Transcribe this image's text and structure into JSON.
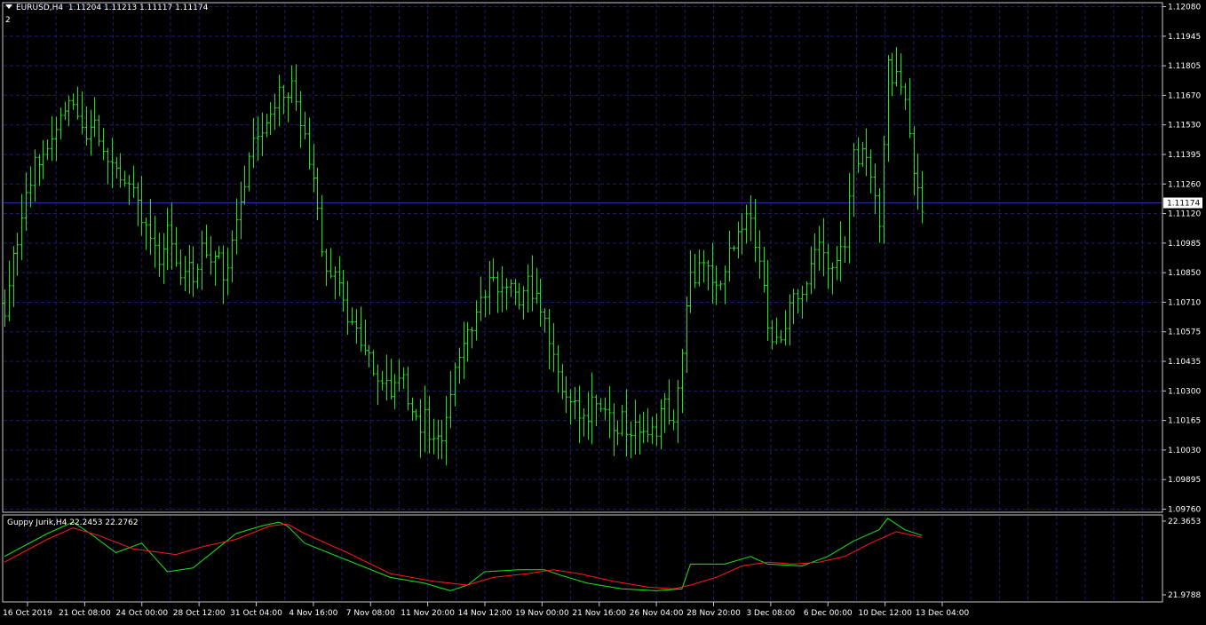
{
  "header": {
    "symbol": "EURUSD,H4",
    "ohlc": "1.11204 1.11213 1.11117 1.11174",
    "line2": "2"
  },
  "indicator": {
    "label": "Guppy Jurik,H4 22.2453 22.2762"
  },
  "colors": {
    "background": "#000000",
    "grid": "#1c1c6e",
    "bars": "#19e619",
    "price_line": "#2a2aa8",
    "price_tag_bg": "#ffffff",
    "fast_line": "#19e619",
    "slow_line": "#ff1a1a",
    "axis": "#c8c8c8"
  },
  "chart_data": [
    {
      "type": "ohlc",
      "title": "EURUSD,H4",
      "ylim": [
        1.0976,
        1.1208
      ],
      "y_ticks": [
        "1.12080",
        "1.11945",
        "1.11805",
        "1.11670",
        "1.11530",
        "1.11395",
        "1.11260",
        "1.11120",
        "1.10985",
        "1.10850",
        "1.10710",
        "1.10575",
        "1.10435",
        "1.10300",
        "1.10165",
        "1.10030",
        "1.09895",
        "1.09760"
      ],
      "current_price": "1.11174",
      "x_labels": [
        "16 Oct 2019",
        "21 Oct 08:00",
        "24 Oct 00:00",
        "28 Oct 12:00",
        "31 Oct 04:00",
        "4 Nov 16:00",
        "7 Nov 08:00",
        "11 Nov 20:00",
        "14 Nov 12:00",
        "19 Nov 00:00",
        "21 Nov 16:00",
        "26 Nov 04:00",
        "28 Nov 20:00",
        "3 Dec 08:00",
        "6 Dec 00:00",
        "10 Dec 12:00",
        "13 Dec 04:00"
      ],
      "grid": true,
      "close_path": [
        [
          0,
          1.1071
        ],
        [
          6,
          1.1128
        ],
        [
          8,
          1.1138
        ],
        [
          14,
          1.1158
        ],
        [
          16,
          1.1168
        ],
        [
          18,
          1.1152
        ],
        [
          22,
          1.115
        ],
        [
          26,
          1.1135
        ],
        [
          30,
          1.1125
        ],
        [
          32,
          1.1112
        ],
        [
          34,
          1.1098
        ],
        [
          36,
          1.1092
        ],
        [
          38,
          1.1102
        ],
        [
          40,
          1.109
        ],
        [
          42,
          1.1083
        ],
        [
          44,
          1.1087
        ],
        [
          46,
          1.1095
        ],
        [
          48,
          1.1092
        ],
        [
          50,
          1.1092
        ],
        [
          52,
          1.1082
        ],
        [
          54,
          1.1112
        ],
        [
          56,
          1.1122
        ],
        [
          58,
          1.1148
        ],
        [
          60,
          1.1152
        ],
        [
          62,
          1.1162
        ],
        [
          64,
          1.1168
        ],
        [
          66,
          1.117
        ],
        [
          68,
          1.1168
        ],
        [
          70,
          1.1148
        ],
        [
          72,
          1.1128
        ],
        [
          74,
          1.1092
        ],
        [
          76,
          1.108
        ],
        [
          78,
          1.1085
        ],
        [
          80,
          1.1066
        ],
        [
          82,
          1.1056
        ],
        [
          84,
          1.105
        ],
        [
          86,
          1.1038
        ],
        [
          88,
          1.1031
        ],
        [
          90,
          1.1033
        ],
        [
          92,
          1.104
        ],
        [
          94,
          1.1027
        ],
        [
          96,
          1.1018
        ],
        [
          98,
          1.1016
        ],
        [
          100,
          1.1005
        ],
        [
          102,
          1.1013
        ],
        [
          104,
          1.1027
        ],
        [
          106,
          1.1045
        ],
        [
          108,
          1.1057
        ],
        [
          110,
          1.107
        ],
        [
          112,
          1.108
        ],
        [
          114,
          1.1084
        ],
        [
          116,
          1.108
        ],
        [
          118,
          1.1078
        ],
        [
          120,
          1.1073
        ],
        [
          122,
          1.108
        ],
        [
          124,
          1.1072
        ],
        [
          126,
          1.1066
        ],
        [
          128,
          1.105
        ],
        [
          130,
          1.103
        ],
        [
          132,
          1.1023
        ],
        [
          134,
          1.102
        ],
        [
          136,
          1.1022
        ],
        [
          138,
          1.1025
        ],
        [
          140,
          1.102
        ],
        [
          142,
          1.1018
        ],
        [
          144,
          1.1015
        ],
        [
          146,
          1.1012
        ],
        [
          148,
          1.1014
        ],
        [
          150,
          1.101
        ],
        [
          152,
          1.1015
        ],
        [
          154,
          1.1022
        ],
        [
          156,
          1.102
        ],
        [
          158,
          1.105
        ],
        [
          160,
          1.1082
        ],
        [
          162,
          1.109
        ],
        [
          164,
          1.1085
        ],
        [
          166,
          1.108
        ],
        [
          168,
          1.109
        ],
        [
          170,
          1.1096
        ],
        [
          172,
          1.1106
        ],
        [
          174,
          1.111
        ],
        [
          176,
          1.1095
        ],
        [
          178,
          1.1062
        ],
        [
          180,
          1.1055
        ],
        [
          182,
          1.1062
        ],
        [
          184,
          1.107
        ],
        [
          186,
          1.108
        ],
        [
          188,
          1.109
        ],
        [
          190,
          1.1096
        ],
        [
          192,
          1.1093
        ],
        [
          194,
          1.1085
        ],
        [
          196,
          1.11
        ],
        [
          198,
          1.114
        ],
        [
          200,
          1.1142
        ],
        [
          202,
          1.1125
        ],
        [
          204,
          1.111
        ],
        [
          206,
          1.118
        ],
        [
          208,
          1.1175
        ],
        [
          210,
          1.116
        ],
        [
          212,
          1.1135
        ],
        [
          214,
          1.1117
        ]
      ],
      "total_bars": 216
    },
    {
      "type": "line",
      "title": "Guppy Jurik,H4",
      "ylim": [
        21.9788,
        22.3653
      ],
      "y_ticks": [
        "22.3653",
        "21.9788"
      ],
      "series": [
        {
          "name": "",
          "color": "fast",
          "values": [
            [
              0,
              22.18
            ],
            [
              10,
              22.3
            ],
            [
              16,
              22.36
            ],
            [
              20,
              22.3
            ],
            [
              26,
              22.2
            ],
            [
              32,
              22.25
            ],
            [
              38,
              22.1
            ],
            [
              44,
              22.12
            ],
            [
              54,
              22.3
            ],
            [
              60,
              22.34
            ],
            [
              64,
              22.36
            ],
            [
              66,
              22.34
            ],
            [
              70,
              22.25
            ],
            [
              80,
              22.16
            ],
            [
              90,
              22.07
            ],
            [
              98,
              22.04
            ],
            [
              104,
              22.0
            ],
            [
              108,
              22.03
            ],
            [
              112,
              22.1
            ],
            [
              120,
              22.11
            ],
            [
              126,
              22.11
            ],
            [
              130,
              22.08
            ],
            [
              136,
              22.04
            ],
            [
              144,
              22.01
            ],
            [
              152,
              22.0
            ],
            [
              158,
              22.01
            ],
            [
              160,
              22.14
            ],
            [
              168,
              22.14
            ],
            [
              174,
              22.18
            ],
            [
              178,
              22.14
            ],
            [
              186,
              22.13
            ],
            [
              192,
              22.18
            ],
            [
              198,
              22.26
            ],
            [
              204,
              22.32
            ],
            [
              206,
              22.38
            ],
            [
              208,
              22.35
            ],
            [
              210,
              22.32
            ],
            [
              214,
              22.29
            ]
          ]
        },
        {
          "name": "",
          "color": "slow",
          "values": [
            [
              0,
              22.15
            ],
            [
              10,
              22.27
            ],
            [
              16,
              22.33
            ],
            [
              22,
              22.29
            ],
            [
              30,
              22.22
            ],
            [
              40,
              22.19
            ],
            [
              46,
              22.23
            ],
            [
              54,
              22.27
            ],
            [
              62,
              22.34
            ],
            [
              66,
              22.35
            ],
            [
              70,
              22.3
            ],
            [
              80,
              22.2
            ],
            [
              90,
              22.09
            ],
            [
              100,
              22.05
            ],
            [
              108,
              22.03
            ],
            [
              114,
              22.07
            ],
            [
              122,
              22.09
            ],
            [
              128,
              22.11
            ],
            [
              134,
              22.09
            ],
            [
              142,
              22.05
            ],
            [
              150,
              22.02
            ],
            [
              156,
              22.01
            ],
            [
              160,
              22.03
            ],
            [
              166,
              22.07
            ],
            [
              172,
              22.13
            ],
            [
              178,
              22.15
            ],
            [
              184,
              22.14
            ],
            [
              190,
              22.15
            ],
            [
              196,
              22.18
            ],
            [
              202,
              22.25
            ],
            [
              208,
              22.31
            ],
            [
              214,
              22.28
            ]
          ]
        }
      ]
    }
  ]
}
